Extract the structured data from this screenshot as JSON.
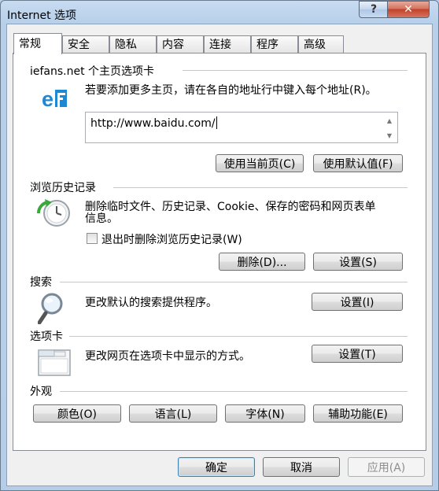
{
  "window": {
    "title": "Internet 选项",
    "help_glyph": "?",
    "close_glyph": "✕"
  },
  "tabs": [
    "常规",
    "安全",
    "隐私",
    "内容",
    "连接",
    "程序",
    "高级"
  ],
  "homepage": {
    "group_label": "iefans.net 个主页选项卡",
    "description": "若要添加更多主页，请在各自的地址行中键入每个地址(R)。",
    "url": "http://www.baidu.com/",
    "use_current_label": "使用当前页(C)",
    "use_default_label": "使用默认值(F)"
  },
  "history": {
    "group_label": "浏览历史记录",
    "description_line1": "删除临时文件、历史记录、Cookie、保存的密码和网页表单",
    "description_line2": "信息。",
    "checkbox_label": "退出时删除浏览历史记录(W)",
    "checkbox_checked": false,
    "delete_label": "删除(D)...",
    "settings_label": "设置(S)"
  },
  "search": {
    "group_label": "搜索",
    "description": "更改默认的搜索提供程序。",
    "settings_label": "设置(I)"
  },
  "tabs_section": {
    "group_label": "选项卡",
    "description": "更改网页在选项卡中显示的方式。",
    "settings_label": "设置(T)"
  },
  "appearance": {
    "group_label": "外观",
    "colors_label": "颜色(O)",
    "languages_label": "语言(L)",
    "fonts_label": "字体(N)",
    "accessibility_label": "辅助功能(E)"
  },
  "footer": {
    "ok_label": "确定",
    "cancel_label": "取消",
    "apply_label": "应用(A)"
  },
  "colors": {
    "accent_blue": "#1e88d2",
    "title_bar": "#b9d1ea"
  }
}
